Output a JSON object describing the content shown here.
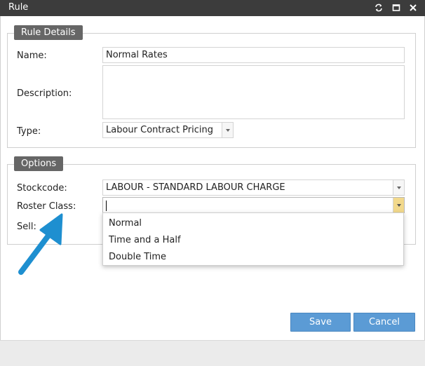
{
  "window": {
    "title": "Rule"
  },
  "rule_details": {
    "section_title": "Rule Details",
    "name_label": "Name:",
    "name_value": "Normal Rates",
    "description_label": "Description:",
    "description_value": "",
    "type_label": "Type:",
    "type_value": "Labour Contract Pricing"
  },
  "options": {
    "section_title": "Options",
    "stockcode_label": "Stockcode:",
    "stockcode_value": "LABOUR - STANDARD LABOUR CHARGE",
    "roster_class_label": "Roster Class:",
    "roster_class_value": "",
    "sell_label": "Sell:",
    "roster_class_options": [
      "Normal",
      "Time and a Half",
      "Double Time"
    ]
  },
  "buttons": {
    "save": "Save",
    "cancel": "Cancel"
  },
  "colors": {
    "titlebar": "#3c3c3c",
    "section_header": "#666666",
    "button": "#5b9bd5",
    "arrow": "#1e8fd0",
    "active_dropdown": "#f2d98c"
  },
  "icons": {
    "window_controls": [
      "refresh-icon",
      "maximize-icon",
      "close-icon"
    ],
    "annotation": "arrow-annotation"
  }
}
